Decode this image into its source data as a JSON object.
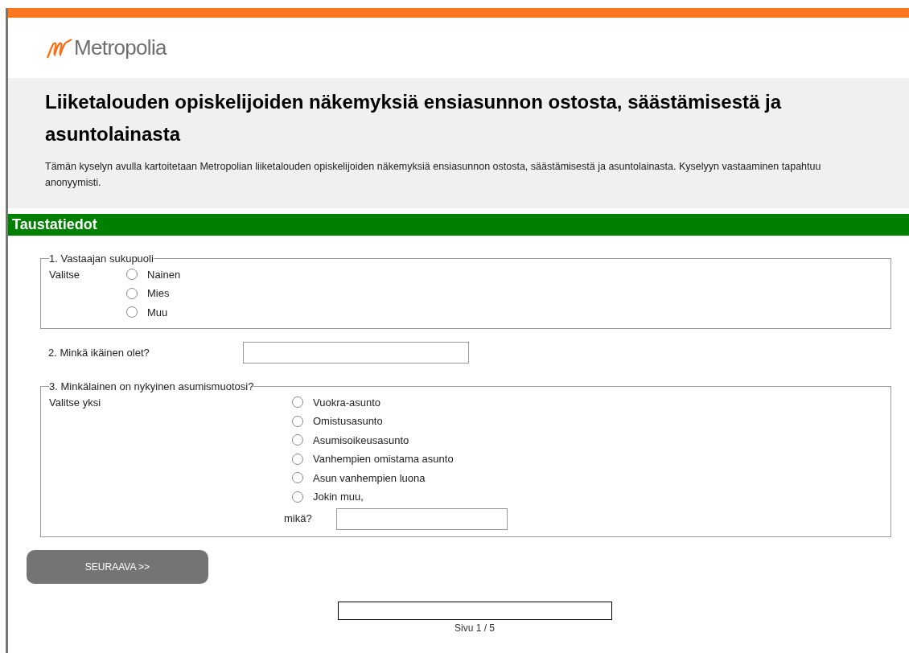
{
  "logo": {
    "text": "Metropolia"
  },
  "header": {
    "title": "Liiketalouden opiskelijoiden näkemyksiä ensiasunnon ostosta, säästämisestä ja asuntolainasta",
    "intro": "Tämän kyselyn avulla kartoitetaan Metropolian liiketalouden opiskelijoiden näkemyksiä ensiasunnon ostosta, säästämisestä ja asuntolainasta. Kyselyyn vastaaminen tapahtuu anonyymisti."
  },
  "section": {
    "title": "Taustatiedot"
  },
  "questions": [
    {
      "kind": "radio",
      "legend": "1. Vastaajan sukupuoli",
      "hint": "Valitse",
      "options": [
        {
          "label": "Nainen",
          "selected": false
        },
        {
          "label": "Mies",
          "selected": false
        },
        {
          "label": "Muu",
          "selected": false
        }
      ]
    },
    {
      "kind": "text",
      "label": "2. Minkä ikäinen olet?"
    },
    {
      "kind": "radio",
      "legend": "3. Minkälainen on nykyinen asumismuotosi?",
      "hint": "Valitse yksi",
      "options": [
        {
          "label": "Vuokra-asunto",
          "selected": false
        },
        {
          "label": "Omistusasunto",
          "selected": false
        },
        {
          "label": "Asumisoikeusasunto",
          "selected": false
        },
        {
          "label": "Vanhempien omistama asunto",
          "selected": false
        },
        {
          "label": "Asun vanhempien luona",
          "selected": false
        },
        {
          "label": "Jokin muu,",
          "selected": false
        }
      ],
      "other_label": "mikä?"
    }
  ],
  "next_button": "SEURAAVA >>",
  "progress": {
    "label": "Sivu 1 / 5"
  }
}
